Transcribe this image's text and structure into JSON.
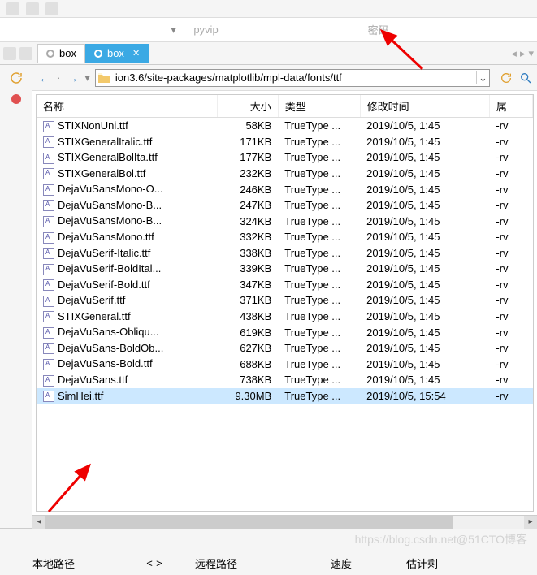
{
  "credentials": {
    "user_placeholder": "pyvip",
    "pass_placeholder": "密码"
  },
  "tabs": {
    "inactive_label": "box",
    "active_label": "box"
  },
  "nav": {
    "path": "ion3.6/site-packages/matplotlib/mpl-data/fonts/ttf"
  },
  "columns": {
    "name": "名称",
    "size": "大小",
    "type": "类型",
    "modified": "修改时间",
    "attr": "属"
  },
  "files": [
    {
      "name": "STIXNonUni.ttf",
      "size": "58KB",
      "type": "TrueType ...",
      "date": "2019/10/5, 1:45",
      "attr": "-rv",
      "sel": false
    },
    {
      "name": "STIXGeneralItalic.ttf",
      "size": "171KB",
      "type": "TrueType ...",
      "date": "2019/10/5, 1:45",
      "attr": "-rv",
      "sel": false
    },
    {
      "name": "STIXGeneralBolIta.ttf",
      "size": "177KB",
      "type": "TrueType ...",
      "date": "2019/10/5, 1:45",
      "attr": "-rv",
      "sel": false
    },
    {
      "name": "STIXGeneralBol.ttf",
      "size": "232KB",
      "type": "TrueType ...",
      "date": "2019/10/5, 1:45",
      "attr": "-rv",
      "sel": false
    },
    {
      "name": "DejaVuSansMono-O...",
      "size": "246KB",
      "type": "TrueType ...",
      "date": "2019/10/5, 1:45",
      "attr": "-rv",
      "sel": false
    },
    {
      "name": "DejaVuSansMono-B...",
      "size": "247KB",
      "type": "TrueType ...",
      "date": "2019/10/5, 1:45",
      "attr": "-rv",
      "sel": false
    },
    {
      "name": "DejaVuSansMono-B...",
      "size": "324KB",
      "type": "TrueType ...",
      "date": "2019/10/5, 1:45",
      "attr": "-rv",
      "sel": false
    },
    {
      "name": "DejaVuSansMono.ttf",
      "size": "332KB",
      "type": "TrueType ...",
      "date": "2019/10/5, 1:45",
      "attr": "-rv",
      "sel": false
    },
    {
      "name": "DejaVuSerif-Italic.ttf",
      "size": "338KB",
      "type": "TrueType ...",
      "date": "2019/10/5, 1:45",
      "attr": "-rv",
      "sel": false
    },
    {
      "name": "DejaVuSerif-BoldItal...",
      "size": "339KB",
      "type": "TrueType ...",
      "date": "2019/10/5, 1:45",
      "attr": "-rv",
      "sel": false
    },
    {
      "name": "DejaVuSerif-Bold.ttf",
      "size": "347KB",
      "type": "TrueType ...",
      "date": "2019/10/5, 1:45",
      "attr": "-rv",
      "sel": false
    },
    {
      "name": "DejaVuSerif.ttf",
      "size": "371KB",
      "type": "TrueType ...",
      "date": "2019/10/5, 1:45",
      "attr": "-rv",
      "sel": false
    },
    {
      "name": "STIXGeneral.ttf",
      "size": "438KB",
      "type": "TrueType ...",
      "date": "2019/10/5, 1:45",
      "attr": "-rv",
      "sel": false
    },
    {
      "name": "DejaVuSans-Obliqu...",
      "size": "619KB",
      "type": "TrueType ...",
      "date": "2019/10/5, 1:45",
      "attr": "-rv",
      "sel": false
    },
    {
      "name": "DejaVuSans-BoldOb...",
      "size": "627KB",
      "type": "TrueType ...",
      "date": "2019/10/5, 1:45",
      "attr": "-rv",
      "sel": false
    },
    {
      "name": "DejaVuSans-Bold.ttf",
      "size": "688KB",
      "type": "TrueType ...",
      "date": "2019/10/5, 1:45",
      "attr": "-rv",
      "sel": false
    },
    {
      "name": "DejaVuSans.ttf",
      "size": "738KB",
      "type": "TrueType ...",
      "date": "2019/10/5, 1:45",
      "attr": "-rv",
      "sel": false
    },
    {
      "name": "SimHei.ttf",
      "size": "9.30MB",
      "type": "TrueType ...",
      "date": "2019/10/5, 15:54",
      "attr": "-rv",
      "sel": true
    }
  ],
  "status": {
    "local": "本地路径",
    "arrow": "<->",
    "remote": "远程路径",
    "speed": "速度",
    "est": "估计剩"
  },
  "watermark": "https://blog.csdn.net@51CTO博客"
}
